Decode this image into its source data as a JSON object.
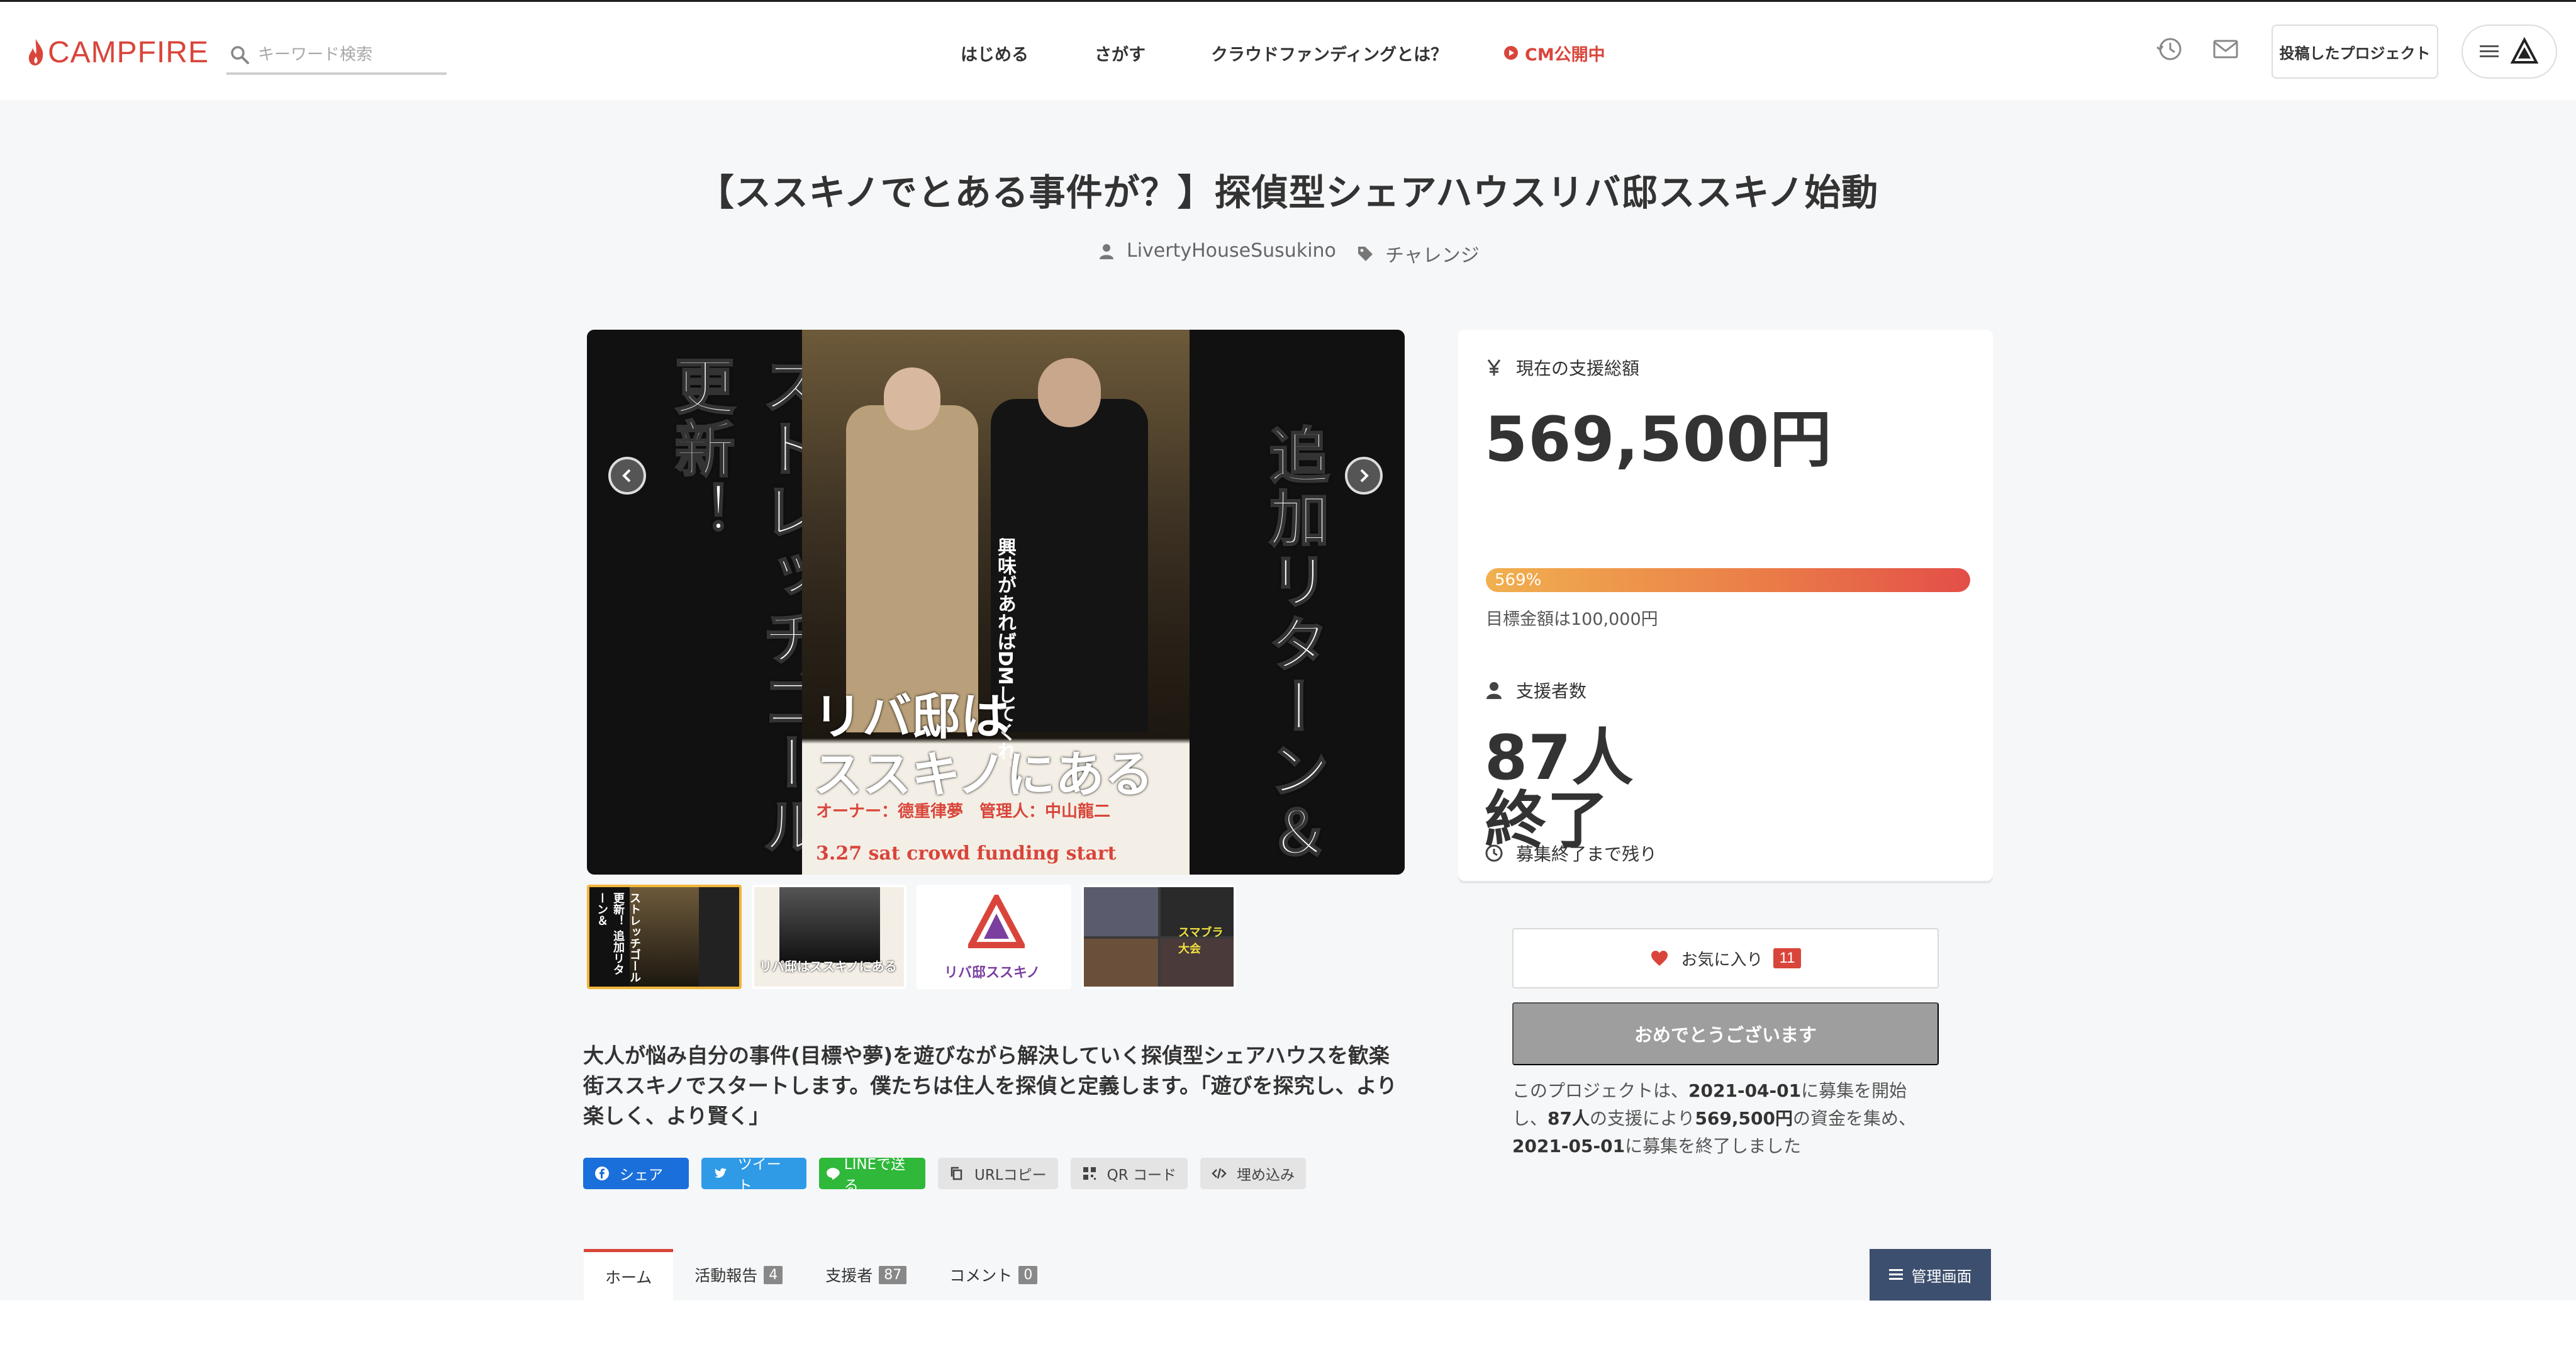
{
  "header": {
    "logo_text": "CAMPFIRE",
    "search_placeholder": "キーワード検索",
    "nav": [
      "はじめる",
      "さがす",
      "クラウドファンディングとは？",
      "CM公開中"
    ],
    "posted_projects_label": "投稿したプロジェクト"
  },
  "project": {
    "title": "【ススキノでとある事件が？】探偵型シェアハウスリバ邸ススキノ始動",
    "owner": "LivertyHouseSusukino",
    "category": "チャレンジ",
    "hero": {
      "left_text": "ストレッチゴール更新！",
      "right_text": "追加リターン＆",
      "poster_title_1": "リバ邸は",
      "poster_title_2": "ススキノにある",
      "poster_vertical": "興味があればDMしてくれ。",
      "poster_owner": "オーナー：德重律夢　管理人：中山龍二",
      "poster_start": "3.27 sat crowd funding start"
    },
    "thumbnails": [
      {
        "label": "ストレッチゴール更新！ 追加リターン＆"
      },
      {
        "label": "リバ邸はススキノにある"
      },
      {
        "label": "リバ邸ススキノ"
      },
      {
        "label": "スマブラ大会"
      }
    ],
    "description": "大人が悩み自分の事件(目標や夢)を遊びながら解決していく探偵型シェアハウスを歓楽街ススキノでスタートします。僕たちは住人を探偵と定義します。「遊びを探究し、より楽しく、より賢く」",
    "share_buttons": [
      "シェア",
      "ツイート",
      "LINEで送る",
      "URLコピー",
      "QR コード",
      "埋め込み"
    ]
  },
  "stats": {
    "total_label": "現在の支援総額",
    "total": "569,500円",
    "progress_text": "569%",
    "progress_percent": 569,
    "goal_text": "目標金額は100,000円",
    "backers_label": "支援者数",
    "backers": "87人",
    "remaining_label": "募集終了まで残り",
    "remaining": "終了"
  },
  "actions": {
    "favorite_label": "お気に入り",
    "favorite_count": "11",
    "congrats_label": "おめでとうございます",
    "summary_prefix": "このプロジェクトは、",
    "summary_start": "2021-04-01",
    "summary_mid1": "に募集を開始し、",
    "summary_backers": "87人",
    "summary_mid2": "の支援により",
    "summary_amount": "569,500円",
    "summary_mid3": "の資金を集め、",
    "summary_end": "2021-05-01",
    "summary_suffix": "に募集を終了しました"
  },
  "tabs": [
    {
      "label": "ホーム",
      "count": ""
    },
    {
      "label": "活動報告",
      "count": "4"
    },
    {
      "label": "支援者",
      "count": "87"
    },
    {
      "label": "コメント",
      "count": "0"
    }
  ],
  "admin_label": "管理画面",
  "colors": {
    "brand": "#d9453a",
    "admin": "#3d4f6e",
    "facebook": "#1a6fdb",
    "twitter": "#2f9ae6",
    "line": "#2fb83a"
  }
}
